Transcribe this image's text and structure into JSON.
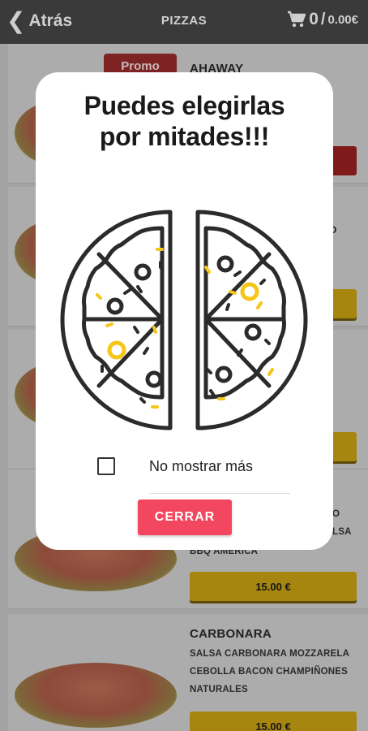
{
  "topbar": {
    "back_label": "Atrás",
    "title": "PIZZAS",
    "cart_count": "0",
    "cart_separator": "/",
    "cart_total": "0.00€"
  },
  "list": {
    "items": [
      {
        "name": "AHAWAY",
        "badge": "Promo"
      },
      {
        "name": "",
        "partial_text": "O"
      },
      {
        "name": ""
      },
      {
        "name": "",
        "desc_partial": [
          "O",
          "LSA",
          "BBQ AMERICA"
        ],
        "price": "15.00 €"
      },
      {
        "name": "CARBONARA",
        "desc": "SALSA CARBONARA MOZZARELA CEBOLLA BACON CHAMPIÑONES NATURALES",
        "price": "15.00 €"
      }
    ]
  },
  "modal": {
    "title_line1": "Puedes elegirlas",
    "title_line2": "por mitades!!!",
    "checkbox_label": "No mostrar más",
    "close_label": "CERRAR"
  },
  "colors": {
    "accent": "#f2475f",
    "price_button": "#f0be17",
    "topbar": "#3a3a3a",
    "promo": "#e23b3b",
    "illustration_line": "#2b2b2b",
    "illustration_yellow": "#f5c518"
  }
}
